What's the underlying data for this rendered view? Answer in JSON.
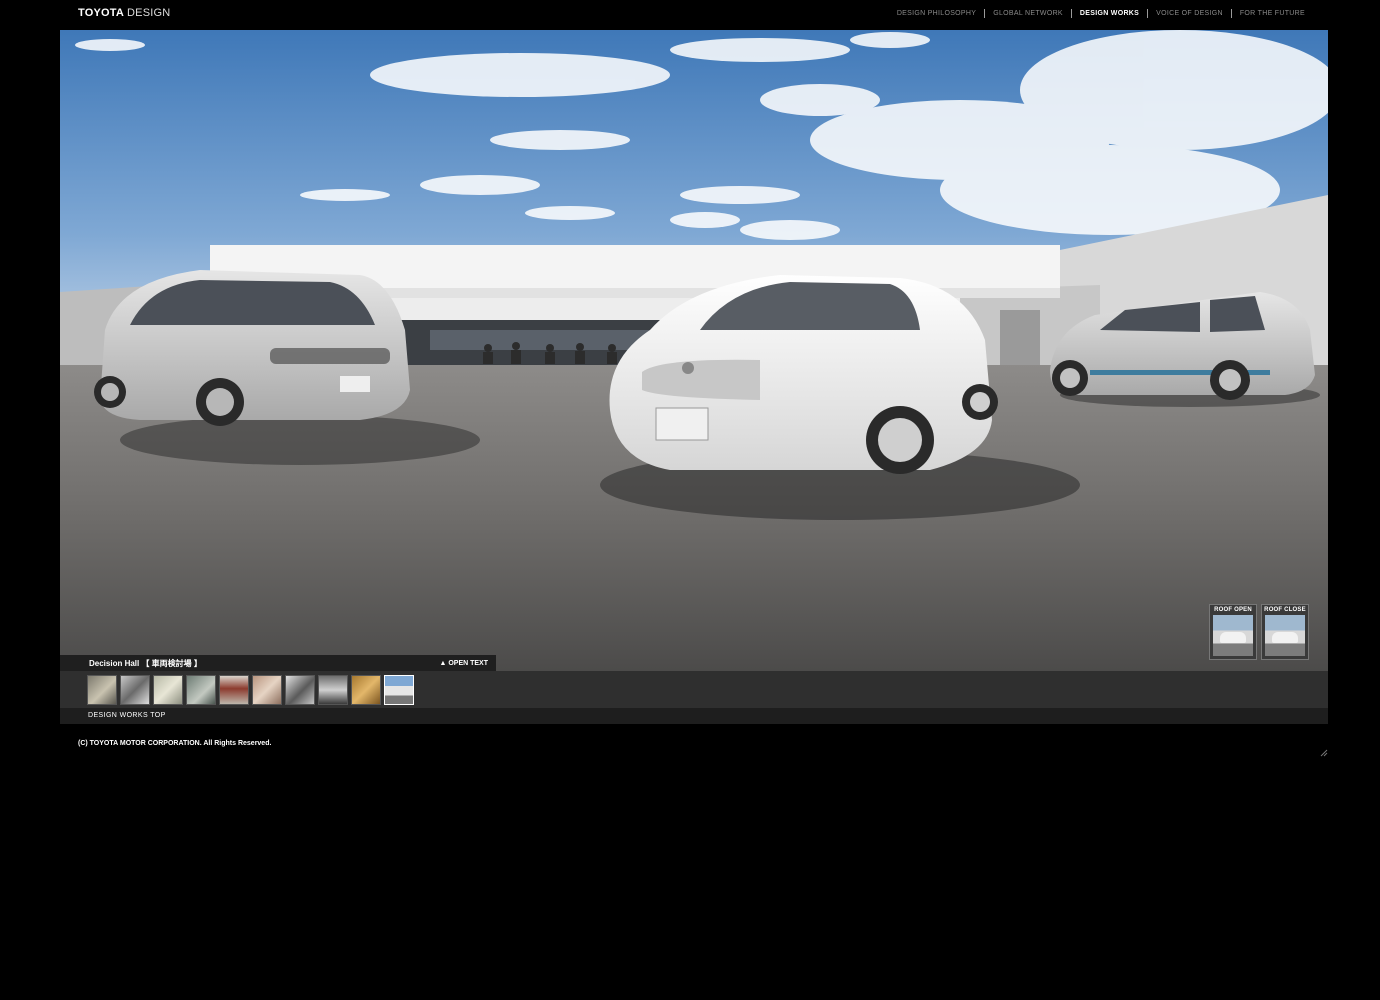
{
  "header": {
    "brand": "TOYOTA",
    "brand_suffix": "DESIGN",
    "nav": [
      {
        "label": "DESIGN PHILOSOPHY",
        "active": false
      },
      {
        "label": "GLOBAL NETWORK",
        "active": false
      },
      {
        "label": "DESIGN WORKS",
        "active": true
      },
      {
        "label": "VOICE OF DESIGN",
        "active": false
      },
      {
        "label": "FOR THE FUTURE",
        "active": false
      }
    ]
  },
  "viewer": {
    "roof_open_label": "ROOF OPEN",
    "roof_close_label": "ROOF CLOSE",
    "caption_title": "Decision Hall 【 車両検討場 】",
    "open_text_label": "▲ OPEN TEXT",
    "thumbnail_count": 10,
    "current_thumbnail": 10
  },
  "footer": {
    "back_link": "DESIGN WORKS TOP",
    "copyright": "(C) TOYOTA MOTOR CORPORATION. All Rights Reserved."
  },
  "colors": {
    "background": "#000000",
    "nav_active": "#ffffff",
    "nav_inactive": "#8a8a8a",
    "sky": "#5b8fc4",
    "ground": "#6f6d6b"
  }
}
